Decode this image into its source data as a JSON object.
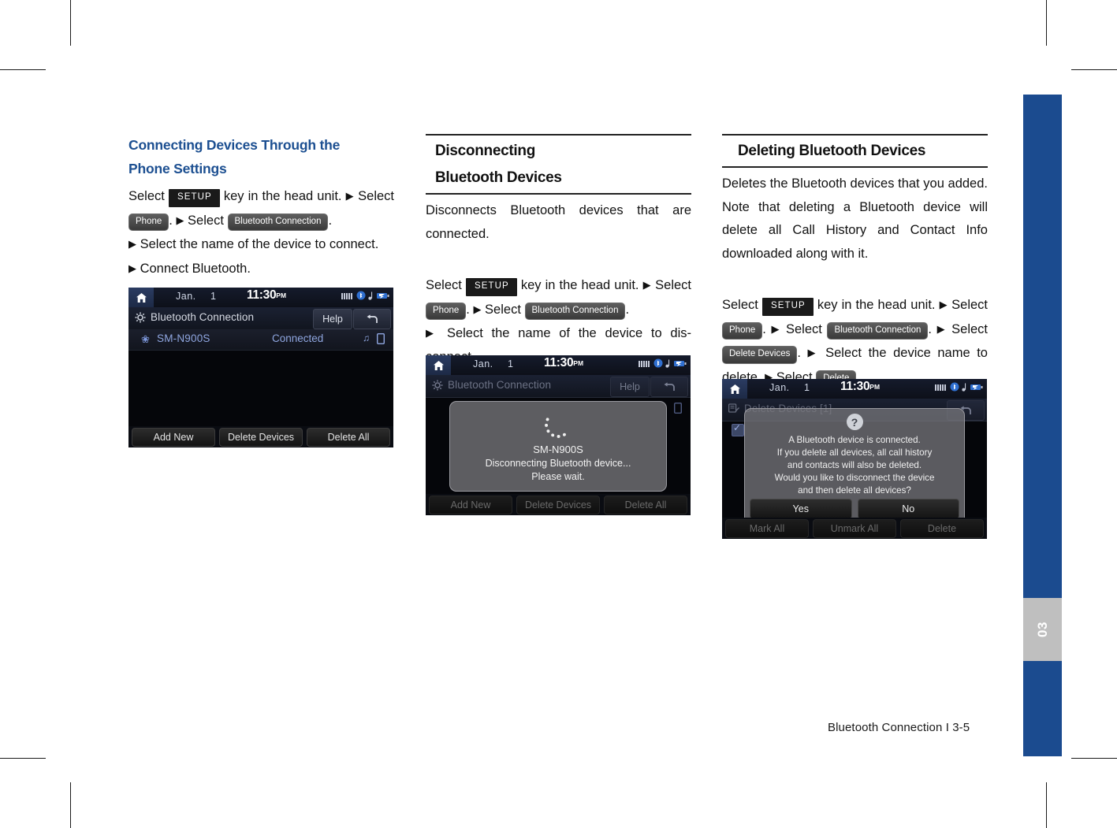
{
  "page": {
    "chapter_number": "03",
    "footer": "Bluetooth Connection I 3-5"
  },
  "columns": [
    {
      "heading": "Connecting Devices Through the Phone Settings",
      "heading_line_1": "Connecting Devices Through the",
      "heading_line_2": "Phone Settings",
      "steps": {
        "select_1": "Select",
        "chip_setup": "SETUP",
        "key_in_head_unit": "key in the head unit.",
        "select_2": "Select",
        "chip_phone": "Phone",
        "select_3": "Select",
        "chip_bt_connection": "Bluetooth Connection",
        "line_select_device": "Select the name of the device to connect.",
        "line_connect": "Connect Bluetooth."
      }
    },
    {
      "heading_line_1": "Disconnecting",
      "heading_line_2": "Bluetooth Devices",
      "intro": "Disconnects Bluetooth devices that are connected.",
      "steps": {
        "select_1": "Select",
        "chip_setup": "SETUP",
        "key_in_head_unit": "key in the head unit.",
        "select_2": "Select",
        "chip_phone": "Phone",
        "select_3": "Select",
        "chip_bt_connection": "Bluetooth Connection",
        "line_select_device": "Select the name of the device to dis-connect."
      }
    },
    {
      "heading": "Deleting Bluetooth Devices",
      "intro": "Deletes the Bluetooth devices that you added. Note that deleting a Bluetooth device will delete all Call History and Contact Info downloaded along with it.",
      "steps": {
        "select_1": "Select",
        "chip_setup": "SETUP",
        "key_in_head_unit": "key in the head unit.",
        "select_2": "Select",
        "chip_phone": "Phone",
        "select_3": "Select",
        "chip_bt_connection": "Bluetooth Connection",
        "select_4": "Select",
        "chip_delete_devices": "Delete Devices",
        "line_select_device": "Select the device name to delete.",
        "select_5": "Select",
        "chip_delete": "Delete"
      }
    }
  ],
  "screens": {
    "status_bar": {
      "month": "Jan.",
      "day": "1",
      "time": "11:30",
      "ampm": "PM"
    },
    "screen1": {
      "title": "Bluetooth Connection",
      "help_label": "Help",
      "device_name": "SM-N900S",
      "device_state": "Connected",
      "buttons": [
        "Add New",
        "Delete Devices",
        "Delete All"
      ]
    },
    "screen2": {
      "title": "Bluetooth Connection",
      "help_label": "Help",
      "modal": {
        "device_name": "SM-N900S",
        "line_1": "Disconnecting Bluetooth device...",
        "line_2": "Please wait."
      },
      "buttons": [
        "Add New",
        "Delete Devices",
        "Delete All"
      ]
    },
    "screen3": {
      "title": "Delete Devices [1]",
      "dialog": {
        "icon": "?",
        "line_1": "A Bluetooth device is connected.",
        "line_2": "If you delete all devices, all call history",
        "line_3": "and contacts will also be deleted.",
        "line_4": "Would you like to disconnect the device",
        "line_5": "and then delete all devices?",
        "yes_label": "Yes",
        "no_label": "No"
      },
      "buttons": [
        "Mark All",
        "Unmark All",
        "Delete"
      ]
    }
  },
  "colors": {
    "accent_blue": "#1c4f91",
    "sidebar_blue": "#1b4b8f",
    "chip_dark": "#1a1a1a"
  }
}
